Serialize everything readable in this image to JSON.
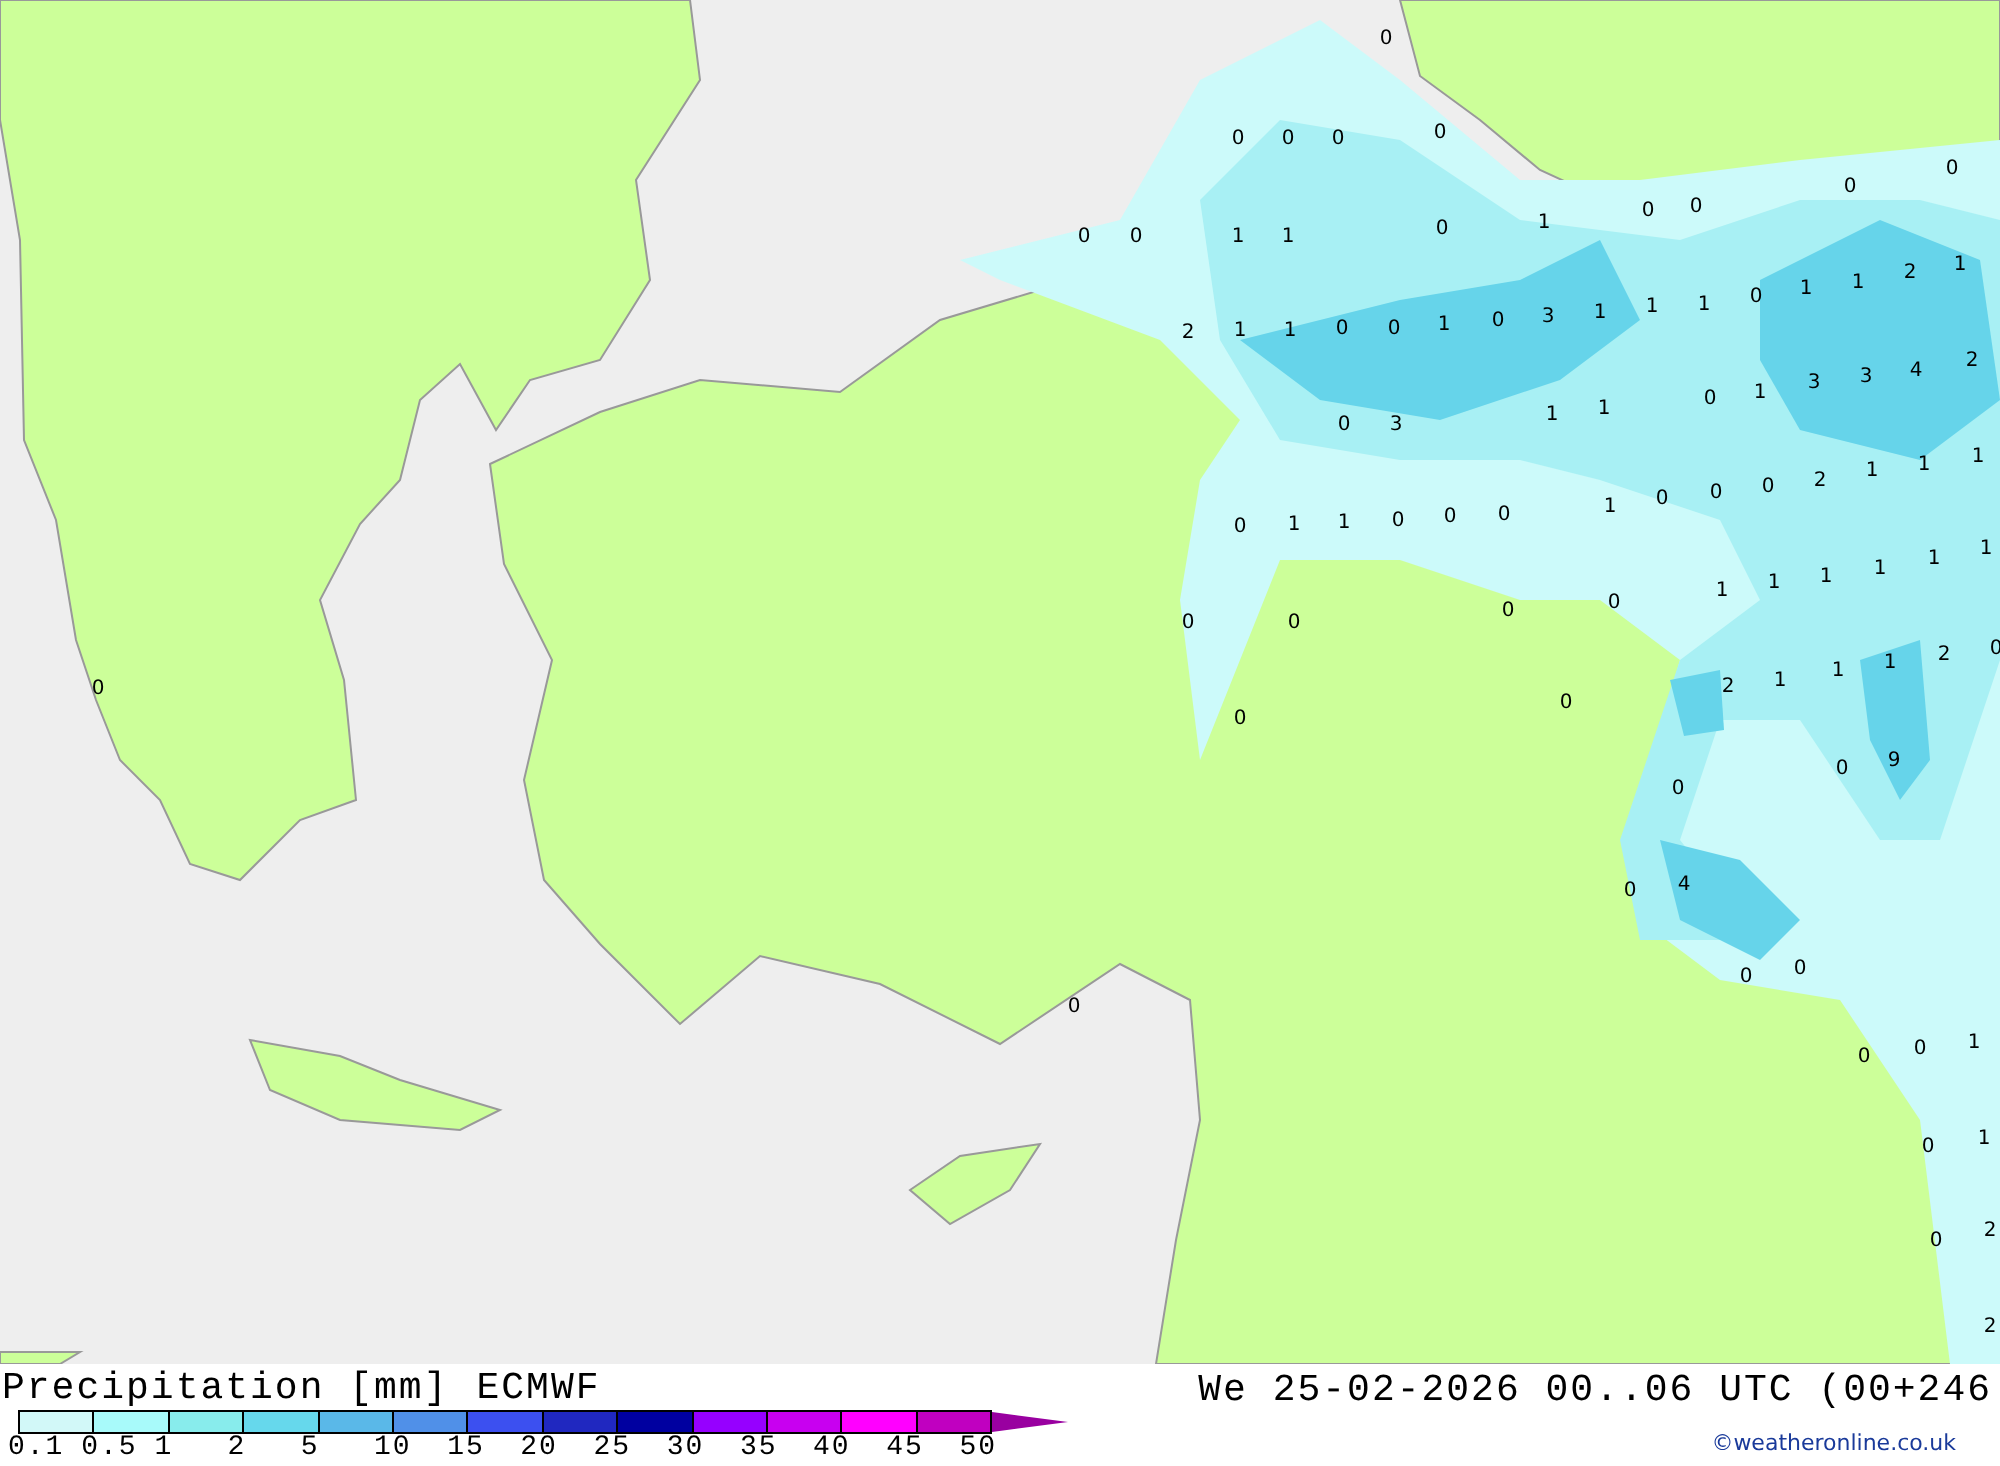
{
  "map": {
    "value_labels": [
      "0",
      "0",
      "0",
      "0",
      "0",
      "0",
      "0",
      "0",
      "0",
      "1",
      "0",
      "0",
      "1",
      "1",
      "0",
      "0",
      "1",
      "1",
      "2",
      "1",
      "2",
      "1",
      "1",
      "0",
      "0",
      "1",
      "0",
      "3",
      "1",
      "1",
      "1",
      "0",
      "1",
      "3",
      "3",
      "4",
      "2",
      "1",
      "1",
      "0",
      "3",
      "0",
      "2",
      "1",
      "1",
      "1",
      "1",
      "0",
      "0",
      "0",
      "1",
      "1",
      "0",
      "0",
      "0",
      "1",
      "1",
      "1",
      "1",
      "1",
      "1",
      "0",
      "0",
      "0",
      "0",
      "2",
      "1",
      "1",
      "1",
      "2",
      "0",
      "0",
      "0",
      "0",
      "0",
      "9",
      "0",
      "0",
      "4",
      "0",
      "0",
      "0",
      "0",
      "0",
      "1",
      "0",
      "1",
      "0",
      "2",
      "2"
    ]
  },
  "legend": {
    "title": "Precipitation [mm]",
    "model": "ECMWF",
    "bins": [
      {
        "color": "#d2f8f8"
      },
      {
        "color": "#a8fafa"
      },
      {
        "color": "#88ecec"
      },
      {
        "color": "#66d8ec"
      },
      {
        "color": "#5ab8e8"
      },
      {
        "color": "#5090e8"
      },
      {
        "color": "#3c50f0"
      },
      {
        "color": "#2028c0"
      },
      {
        "color": "#0000a0"
      },
      {
        "color": "#9600ff"
      },
      {
        "color": "#c800f0"
      },
      {
        "color": "#ff00ff"
      },
      {
        "color": "#c000c0"
      }
    ],
    "ticks": [
      "0.1",
      "0.5",
      "1",
      "2",
      "5",
      "10",
      "15",
      "20",
      "25",
      "30",
      "35",
      "40",
      "45",
      "50"
    ],
    "valid_time": "We 25-02-2026 00..06 UTC (00+246",
    "credit": "©weatheronline.co.uk"
  }
}
